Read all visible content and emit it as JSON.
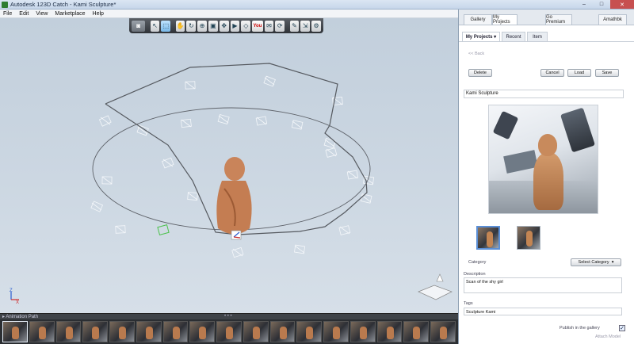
{
  "window": {
    "title": "Autodesk 123D Catch - Kami Sculpture*",
    "controls": [
      "–",
      "□",
      "✕"
    ]
  },
  "menu": [
    "File",
    "Edit",
    "View",
    "Marketplace",
    "Help"
  ],
  "toolbar": {
    "youtube_label": "You"
  },
  "filmstrip": {
    "label": "▸ Animation Path",
    "grip": "• • •",
    "frame_count": 17
  },
  "panel": {
    "top_tabs": [
      "Gallery",
      "My Projects",
      "Go Premium",
      "Amathbk"
    ],
    "sub_tabs": [
      "My Projects ▾",
      "Recent",
      "Item"
    ],
    "back_link": "<< Back",
    "buttons": {
      "delete": "Delete",
      "cancel": "Cancel",
      "load": "Load",
      "save": "Save"
    },
    "project_name": "Kami Sculpture",
    "category_label": "Category",
    "category_select": "Select Category",
    "description_label": "Description",
    "description_value": "Scan of the shy girl",
    "tags_label": "Tags",
    "tags_value": "Sculpture Kami",
    "publish_label": "Publish in the gallery",
    "publish_checked": true,
    "attach_label": "Attach Model"
  },
  "colors": {
    "viewport_bg": "#c9d3dd",
    "path_line": "#5a5e64",
    "sculpture": "#c8845a"
  }
}
